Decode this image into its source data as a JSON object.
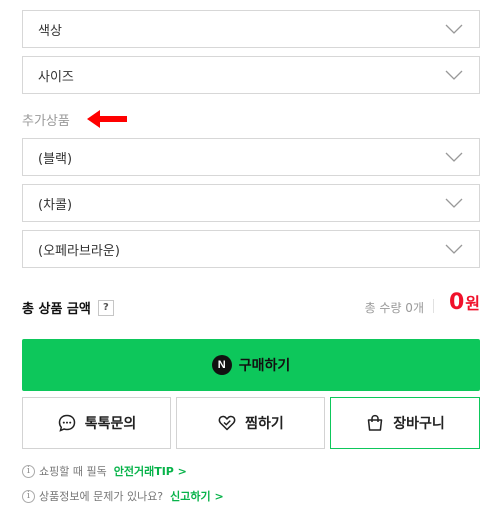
{
  "options": {
    "color": "색상",
    "size": "사이즈",
    "additional_label": "추가상품",
    "additional": [
      "(블랙)",
      "(차콜)",
      "(오페라브라운)"
    ]
  },
  "summary": {
    "total_label": "총 상품 금액",
    "help": "?",
    "quantity_text": "총 수량 0개",
    "price_value": "0",
    "price_unit": "원"
  },
  "actions": {
    "buy_logo": "N",
    "buy_label": "구매하기",
    "talk_label": "톡톡문의",
    "zzim_label": "찜하기",
    "cart_label": "장바구니"
  },
  "notices": {
    "info_glyph": "i",
    "line1_text": "쇼핑할 때 필독",
    "line1_link": "안전거래TIP >",
    "line2_text": "상품정보에 문제가 있나요?",
    "line2_link": "신고하기 >"
  },
  "colors": {
    "accent_green": "#0dc75b",
    "price_red": "#f0112b",
    "arrow_red": "#ff0000"
  },
  "icons": [
    "chevron-down-icon",
    "left-arrow-icon",
    "naver-n-icon",
    "chat-bubble-icon",
    "heart-icon",
    "shopping-bag-icon",
    "info-icon"
  ]
}
